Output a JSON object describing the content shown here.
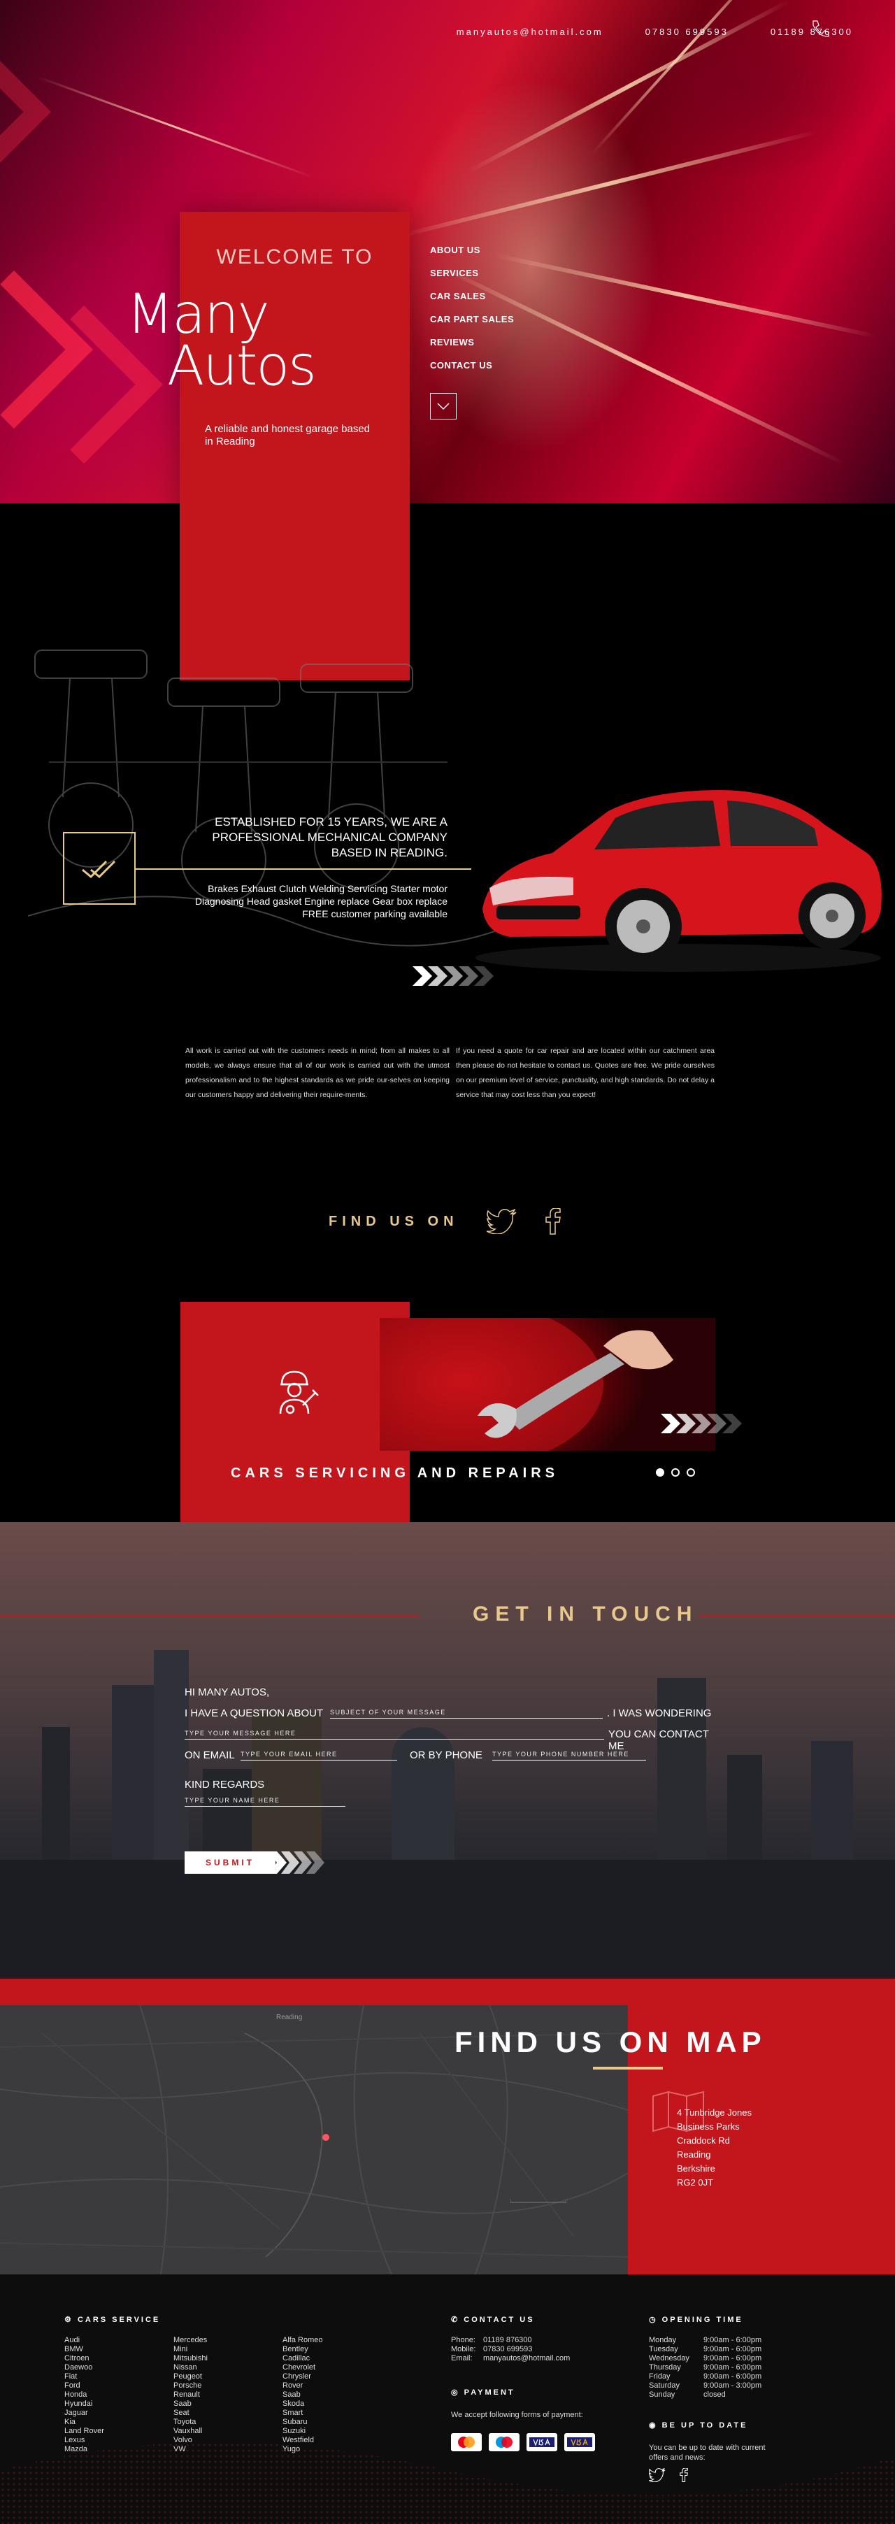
{
  "header": {
    "email": "manyautos@hotmail.com",
    "phone_mobile": "07830 699593",
    "phone_landline": "01189 876300"
  },
  "welcome": {
    "title": "WELCOME TO",
    "logo_line1": "Many",
    "logo_line2": "Autos",
    "tagline": "A reliable and honest garage based in Reading"
  },
  "nav": {
    "items": [
      "ABOUT US",
      "SERVICES",
      "CAR SALES",
      "CAR PART SALES",
      "REVIEWS",
      "CONTACT US"
    ]
  },
  "intro": {
    "established": "ESTABLISHED FOR 15 YEARS, WE ARE A PROFESSIONAL MECHANICAL COMPANY BASED IN READING.",
    "services": "Brakes  Exhaust  Clutch  Welding  Servicing  Starter motor  Diagnosing  Head gasket  Engine replace  Gear box replace  FREE customer parking available"
  },
  "about": {
    "left": "All work is carried out with the customers needs in mind; from all makes to all models, we always ensure that all of our work is carried out with the utmost professionalism and to the highest standards as we pride our-selves on keeping our customers happy and delivering their require-ments.",
    "right": "If you need a quote for car repair and are located within our catchment area then please do not hesitate to contact us. Quotes are free. We pride ourselves on our premium level of service, punctuality, and high standards. Do not delay a service that may cost less than you expect!"
  },
  "social": {
    "label": "FIND US ON"
  },
  "services_slider": {
    "heading": "CARS SERVICING AND REPAIRS",
    "slides": 3,
    "active_slide": 1
  },
  "contact": {
    "title": "GET IN TOUCH",
    "greeting": "HI MANY AUTOS,",
    "question": "I HAVE A QUESTION ABOUT",
    "subject_placeholder": "SUBJECT OF YOUR MESSAGE",
    "wondering": ". I WAS WONDERING",
    "message_placeholder": "TYPE YOUR MESSAGE HERE",
    "contact_me": "YOU CAN CONTACT ME",
    "on_email": "ON EMAIL",
    "email_placeholder": "TYPE YOUR EMAIL HERE",
    "or_phone": "OR BY PHONE",
    "phone_placeholder": "TYPE YOUR PHONE NUMBER HERE",
    "regards": "KIND REGARDS",
    "name_placeholder": "TYPE YOUR NAME HERE",
    "submit": "SUBMIT"
  },
  "map": {
    "title": "FIND US ON MAP",
    "city_label": "Reading",
    "address": [
      "4 Tunbridge Jones",
      "Business Parks",
      "Craddock Rd",
      "Reading",
      "Berkshire",
      "RG2 0JT"
    ]
  },
  "footer": {
    "cars_heading": "CARS SERVICE",
    "brands_col1": [
      "Audi",
      "BMW",
      "Citroen",
      "Daewoo",
      "Fiat",
      "Ford",
      "Honda",
      "Hyundai",
      "Jaguar",
      "Kia",
      "Land Rover",
      "Lexus",
      "Mazda"
    ],
    "brands_col2": [
      "Mercedes",
      "Mini",
      "Mitsubishi",
      "Nissan",
      "Peugeot",
      "Porsche",
      "Renault",
      "Saab",
      "Seat",
      "Toyota",
      "Vauxhall",
      "Volvo",
      "VW"
    ],
    "brands_col3": [
      "Alfa Romeo",
      "Bentley",
      "Cadillac",
      "Chevrolet",
      "Chrysler",
      "Rover",
      "Saab",
      "Skoda",
      "Smart",
      "Subaru",
      "Suzuki",
      "Westfield",
      "Yugo"
    ],
    "contact_heading": "CONTACT US",
    "contact_rows": [
      {
        "label": "Phone:",
        "value": "01189 876300"
      },
      {
        "label": "Mobile:",
        "value": "07830 699593"
      },
      {
        "label": "Email:",
        "value": "manyautos@hotmail.com"
      }
    ],
    "payment_heading": "PAYMENT",
    "payment_text": "We accept following forms of payment:",
    "hours_heading": "OPENING TIME",
    "hours": [
      {
        "day": "Monday",
        "time": "9:00am - 6:00pm"
      },
      {
        "day": "Tuesday",
        "time": "9:00am - 6:00pm"
      },
      {
        "day": "Wednesday",
        "time": "9:00am - 6:00pm"
      },
      {
        "day": "Thursday",
        "time": "9:00am - 6:00pm"
      },
      {
        "day": "Friday",
        "time": "9:00am - 6:00pm"
      },
      {
        "day": "Saturday",
        "time": "9:00am - 3:00pm"
      },
      {
        "day": "Sunday",
        "time": "closed"
      }
    ],
    "update_heading": "BE UP TO DATE",
    "update_text": "You can be up to date with current offers and news:"
  },
  "colors": {
    "brand_red": "#c3161c",
    "gold": "#e8c98d",
    "background": "#000000"
  },
  "icons": [
    "phone-icon",
    "chevron-down-icon",
    "checkmark-icon",
    "arrows-icon",
    "twitter-icon",
    "facebook-icon",
    "mechanic-icon",
    "map-pin-icon",
    "twitter-icon",
    "facebook-icon"
  ]
}
